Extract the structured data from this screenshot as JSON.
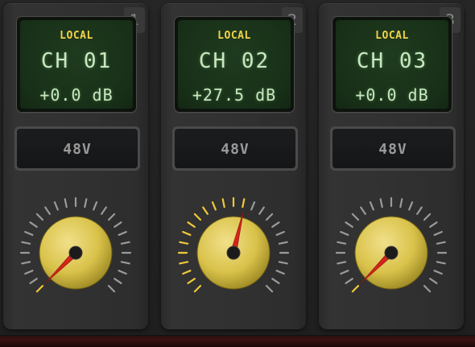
{
  "colors": {
    "lcd_source": "#f2d24a",
    "lcd_text": "#c8e8c0",
    "tick_active": "#f0c93a",
    "tick_inactive": "#9a9a9a",
    "knob_body": "#d9c24a",
    "pointer": "#d4241c"
  },
  "channels": [
    {
      "number": "1",
      "source": "LOCAL",
      "channel_label": "CH 01",
      "gain_label": "+0.0 dB",
      "phantom_label": "48V",
      "knob_fraction": 0.0
    },
    {
      "number": "2",
      "source": "LOCAL",
      "channel_label": "CH 02",
      "gain_label": "+27.5 dB",
      "phantom_label": "48V",
      "knob_fraction": 0.55
    },
    {
      "number": "3",
      "source": "LOCAL",
      "channel_label": "CH 03",
      "gain_label": "+0.0 dB",
      "phantom_label": "48V",
      "knob_fraction": 0.0
    }
  ]
}
